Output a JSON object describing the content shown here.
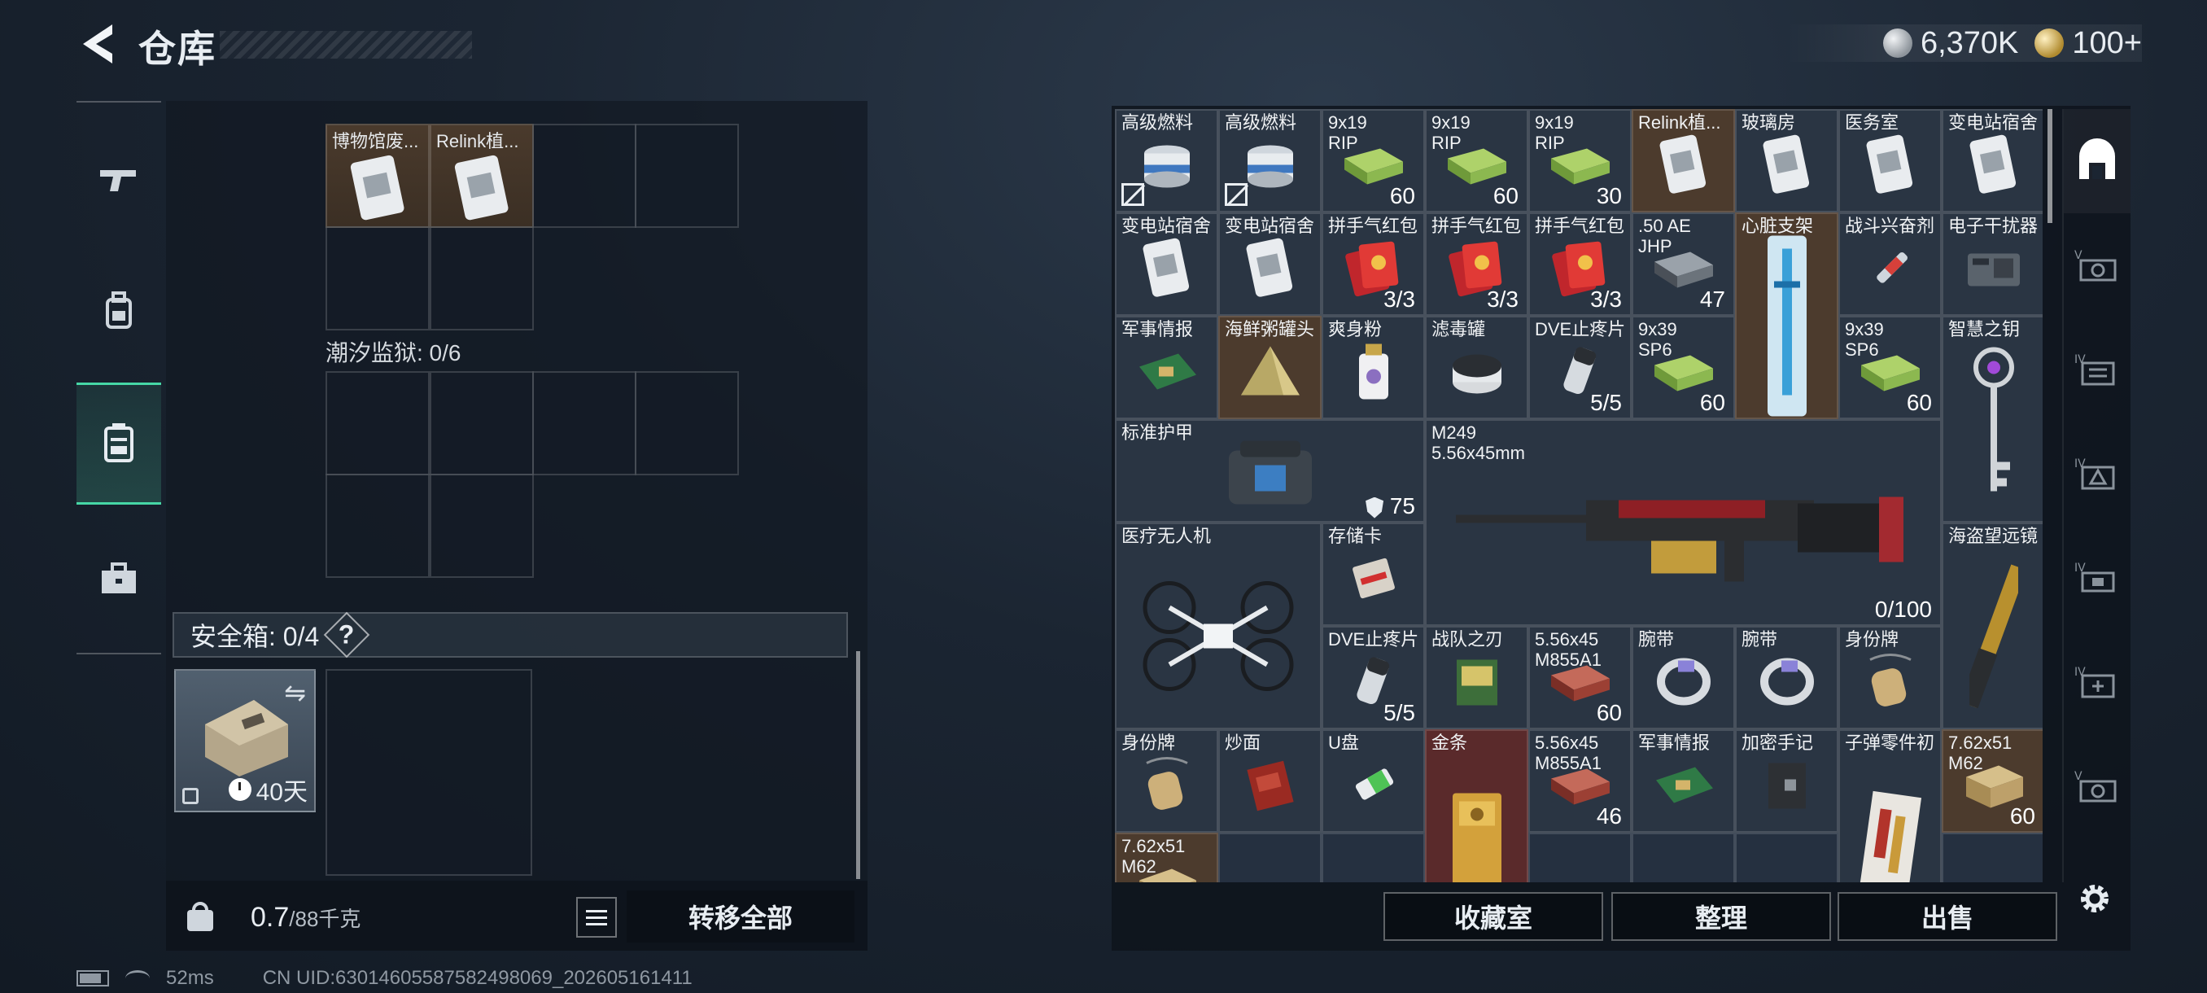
{
  "header": {
    "title": "仓库",
    "currency": [
      {
        "icon": "silver-coin-icon",
        "value": "6,370K"
      },
      {
        "icon": "gold-coin-icon",
        "value": "100+"
      }
    ]
  },
  "left_sidebar": {
    "tabs": [
      {
        "icon": "gun-icon",
        "active": false
      },
      {
        "icon": "backpack-icon",
        "active": false
      },
      {
        "icon": "rig-vest-icon",
        "active": true
      },
      {
        "icon": "briefcase-icon",
        "active": false
      }
    ]
  },
  "left_panel": {
    "top_items": [
      {
        "label": "博物馆废..."
      },
      {
        "label": "Relink植..."
      }
    ],
    "prison_label": "潮汐监狱: 0/6",
    "safe_box_label": "安全箱: 0/4",
    "help_label": "?",
    "safe_box_timer": "40天",
    "weight_value": "0.7",
    "weight_max": "/88千克",
    "transfer_all_label": "转移全部"
  },
  "stash_items": [
    {
      "name": "高级燃料",
      "count": "",
      "flag": "no-trade",
      "bg": "grey",
      "art": "can"
    },
    {
      "name": "高级燃料",
      "count": "",
      "flag": "no-trade",
      "bg": "grey",
      "art": "can"
    },
    {
      "name": "9x19\nRIP",
      "count": "60",
      "bg": "grey",
      "art": "ammo"
    },
    {
      "name": "9x19\nRIP",
      "count": "60",
      "bg": "grey",
      "art": "ammo"
    },
    {
      "name": "9x19\nRIP",
      "count": "30",
      "bg": "grey",
      "art": "ammo"
    },
    {
      "name": "Relink植...",
      "count": "",
      "bg": "brown",
      "art": "bag"
    },
    {
      "name": "玻璃房",
      "count": "",
      "bg": "grey",
      "art": "bag"
    },
    {
      "name": "医务室",
      "count": "",
      "bg": "grey",
      "art": "bag"
    },
    {
      "name": "变电站宿舍",
      "count": "",
      "bg": "grey",
      "art": "bag"
    },
    {
      "name": "变电站宿舍",
      "count": "",
      "bg": "grey",
      "art": "bag"
    },
    {
      "name": "变电站宿舍",
      "count": "",
      "bg": "grey",
      "art": "bag"
    },
    {
      "name": "拼手气红包",
      "count": "3/3",
      "bg": "grey",
      "art": "redpacket"
    },
    {
      "name": "拼手气红包",
      "count": "3/3",
      "bg": "grey",
      "art": "redpacket"
    },
    {
      "name": "拼手气红包",
      "count": "3/3",
      "bg": "grey",
      "art": "redpacket"
    },
    {
      "name": ".50 AE\nJHP",
      "count": "47",
      "bg": "grey",
      "art": "ammo-dark"
    },
    {
      "name": "心脏支架",
      "count": "",
      "bg": "brown",
      "art": "stent"
    },
    {
      "name": "战斗兴奋剂",
      "count": "",
      "bg": "grey",
      "art": "syringe"
    },
    {
      "name": "电子干扰器",
      "count": "",
      "bg": "grey",
      "art": "device"
    },
    {
      "name": "军事情报",
      "count": "",
      "bg": "grey",
      "art": "board"
    },
    {
      "name": "海鲜粥罐头",
      "count": "",
      "bg": "brown",
      "art": "pyramid"
    },
    {
      "name": "爽身粉",
      "count": "",
      "bg": "grey",
      "art": "bottle"
    },
    {
      "name": "滤毒罐",
      "count": "",
      "bg": "grey",
      "art": "filter"
    },
    {
      "name": "DVE止疼片",
      "count": "5/5",
      "bg": "grey",
      "art": "pills"
    },
    {
      "name": "9x39\nSP6",
      "count": "60",
      "bg": "grey",
      "art": "ammo"
    },
    {
      "name": "9x39\nSP6",
      "count": "60",
      "bg": "grey",
      "art": "ammo"
    },
    {
      "name": "智慧之钥",
      "count": "",
      "bg": "grey",
      "art": "key"
    },
    {
      "name": "标准护甲",
      "count": "75",
      "bg": "grey",
      "art": "armor",
      "shield": true
    },
    {
      "name": "M249\n5.56x45mm",
      "count": "0/100",
      "bg": "grey",
      "art": "gun"
    },
    {
      "name": "医疗无人机",
      "count": "",
      "bg": "grey",
      "art": "drone"
    },
    {
      "name": "存储卡",
      "count": "",
      "bg": "grey",
      "art": "card"
    },
    {
      "name": "海盗望远镜",
      "count": "",
      "bg": "grey",
      "art": "scope"
    },
    {
      "name": "DVE止疼片",
      "count": "5/5",
      "bg": "grey",
      "art": "pills"
    },
    {
      "name": "战队之刃",
      "count": "",
      "bg": "grey",
      "art": "book"
    },
    {
      "name": "5.56x45\nM855A1",
      "count": "60",
      "bg": "grey",
      "art": "ammo-red"
    },
    {
      "name": "腕带",
      "count": "",
      "bg": "grey",
      "art": "band"
    },
    {
      "name": "腕带",
      "count": "",
      "bg": "grey",
      "art": "band"
    },
    {
      "name": "身份牌",
      "count": "",
      "bg": "grey",
      "art": "tag"
    },
    {
      "name": "身份牌",
      "count": "",
      "bg": "grey",
      "art": "tag"
    },
    {
      "name": "炒面",
      "count": "",
      "bg": "grey",
      "art": "noodle"
    },
    {
      "name": "U盘",
      "count": "",
      "bg": "grey",
      "art": "usb"
    },
    {
      "name": "金条",
      "count": "",
      "bg": "red",
      "art": "gold"
    },
    {
      "name": "5.56x45\nM855A1",
      "count": "46",
      "bg": "grey",
      "art": "ammo-red"
    },
    {
      "name": "军事情报",
      "count": "",
      "bg": "grey",
      "art": "board"
    },
    {
      "name": "加密手记",
      "count": "",
      "bg": "grey",
      "art": "notebook"
    },
    {
      "name": "子弹零件初",
      "count": "",
      "bg": "grey",
      "art": "parts"
    },
    {
      "name": "7.62x51\nM62",
      "count": "60",
      "bg": "brown",
      "art": "box"
    },
    {
      "name": "7.62x51\nM62",
      "count": "",
      "bg": "brown",
      "art": "box"
    }
  ],
  "bottom_buttons": {
    "collection": "收藏室",
    "organize": "整理",
    "sell": "出售"
  },
  "right_sidebar": {
    "tabs": [
      {
        "icon": "stash-home-icon",
        "active": true
      },
      {
        "icon": "safe-tier-5-icon",
        "active": false
      },
      {
        "icon": "safe-tier-4a-icon",
        "active": false
      },
      {
        "icon": "safe-tier-4b-icon",
        "active": false
      },
      {
        "icon": "safe-tier-4c-icon",
        "active": false
      },
      {
        "icon": "safe-tier-4d-icon",
        "active": false
      },
      {
        "icon": "safe-tier-5b-icon",
        "active": false
      }
    ],
    "settings_icon": "gear-icon"
  },
  "status": {
    "ping": "52ms",
    "uid": "CN UID:6301460558758249806​9_202605161411"
  }
}
